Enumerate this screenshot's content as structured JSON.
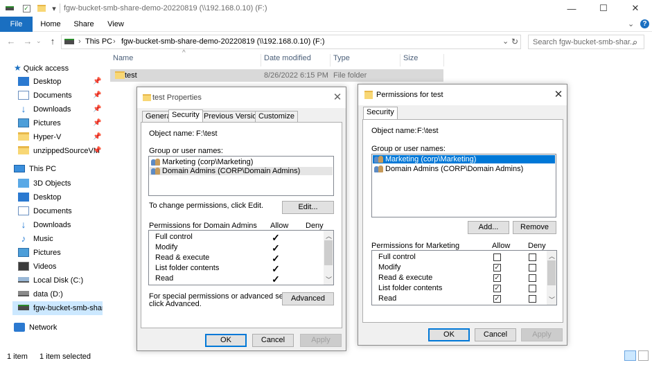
{
  "window": {
    "title": "fgw-bucket-smb-share-demo-20220819 (\\\\192.168.0.10) (F:)",
    "minimize": "—",
    "maximize": "☐",
    "close": "✕"
  },
  "ribbon": {
    "tabs": [
      "File",
      "Home",
      "Share",
      "View"
    ],
    "expand": "⌄",
    "help": "?"
  },
  "nav": {
    "back": "←",
    "forward": "→",
    "up": "↑",
    "breadcrumb": [
      "This PC",
      "fgw-bucket-smb-share-demo-20220819 (\\\\192.168.0.10) (F:)"
    ],
    "separator": "›",
    "dropdown": "⌄",
    "refresh": "↻",
    "search_placeholder": "Search fgw-bucket-smb-shar...",
    "search_icon": "⌕"
  },
  "sidebar": {
    "quick_access": "Quick access",
    "quick_items": [
      {
        "label": "Desktop",
        "icon": "desktop-icon",
        "pinned": true
      },
      {
        "label": "Documents",
        "icon": "documents-icon",
        "pinned": true
      },
      {
        "label": "Downloads",
        "icon": "downloads-icon",
        "pinned": true
      },
      {
        "label": "Pictures",
        "icon": "pictures-icon",
        "pinned": true
      },
      {
        "label": "Hyper-V",
        "icon": "folder-icon",
        "pinned": true
      },
      {
        "label": "unzippedSourceVM",
        "icon": "folder-icon",
        "pinned": true
      }
    ],
    "this_pc": "This PC",
    "pc_items": [
      {
        "label": "3D Objects",
        "icon": "3d-objects-icon"
      },
      {
        "label": "Desktop",
        "icon": "desktop-icon"
      },
      {
        "label": "Documents",
        "icon": "documents-icon"
      },
      {
        "label": "Downloads",
        "icon": "downloads-icon"
      },
      {
        "label": "Music",
        "icon": "music-icon"
      },
      {
        "label": "Pictures",
        "icon": "pictures-icon"
      },
      {
        "label": "Videos",
        "icon": "videos-icon"
      },
      {
        "label": "Local Disk (C:)",
        "icon": "local-disk-icon"
      },
      {
        "label": "data (D:)",
        "icon": "drive-icon"
      },
      {
        "label": "fgw-bucket-smb-share",
        "icon": "network-drive-icon"
      }
    ],
    "network": "Network"
  },
  "filelist": {
    "columns": [
      "Name",
      "Date modified",
      "Type",
      "Size"
    ],
    "sort_indicator": "^",
    "rows": [
      {
        "name": "test",
        "date": "8/26/2022 6:15 PM",
        "type": "File folder",
        "size": ""
      }
    ]
  },
  "status": {
    "items": "1 item",
    "selected": "1 item selected"
  },
  "properties_dialog": {
    "title": "test Properties",
    "tabs": [
      "General",
      "Security",
      "Previous Versions",
      "Customize"
    ],
    "object_name_label": "Object name:",
    "object_name_value": "F:\\test",
    "groups_label": "Group or user names:",
    "groups": [
      "Marketing (corp\\Marketing)",
      "Domain Admins (CORP\\Domain Admins)"
    ],
    "change_text": "To change permissions, click Edit.",
    "edit_button": "Edit...",
    "perms_for": "Permissions for Domain Admins",
    "allow": "Allow",
    "deny": "Deny",
    "permissions": [
      {
        "name": "Full control",
        "allow": true,
        "deny": false
      },
      {
        "name": "Modify",
        "allow": true,
        "deny": false
      },
      {
        "name": "Read & execute",
        "allow": true,
        "deny": false
      },
      {
        "name": "List folder contents",
        "allow": true,
        "deny": false
      },
      {
        "name": "Read",
        "allow": true,
        "deny": false
      }
    ],
    "special_text_1": "For special permissions or advanced settings,",
    "special_text_2": "click Advanced.",
    "advanced_button": "Advanced",
    "ok": "OK",
    "cancel": "Cancel",
    "apply": "Apply",
    "check_glyph": "✓"
  },
  "permissions_dialog": {
    "title": "Permissions for test",
    "tab": "Security",
    "object_name_label": "Object name:",
    "object_name_value": "F:\\test",
    "groups_label": "Group or user names:",
    "groups": [
      "Marketing (corp\\Marketing)",
      "Domain Admins (CORP\\Domain Admins)"
    ],
    "selected_group": 0,
    "add_button": "Add...",
    "remove_button": "Remove",
    "perms_for": "Permissions for Marketing",
    "allow": "Allow",
    "deny": "Deny",
    "permissions": [
      {
        "name": "Full control",
        "allow": false,
        "deny": false
      },
      {
        "name": "Modify",
        "allow": true,
        "deny": false
      },
      {
        "name": "Read & execute",
        "allow": true,
        "deny": false
      },
      {
        "name": "List folder contents",
        "allow": true,
        "deny": false
      },
      {
        "name": "Read",
        "allow": true,
        "deny": false
      }
    ],
    "ok": "OK",
    "cancel": "Cancel",
    "apply": "Apply",
    "check_glyph": "✓"
  },
  "colors": {
    "accent": "#1a6fc1",
    "selection": "#0078d7",
    "dialog_bg": "#f0f0f0"
  }
}
